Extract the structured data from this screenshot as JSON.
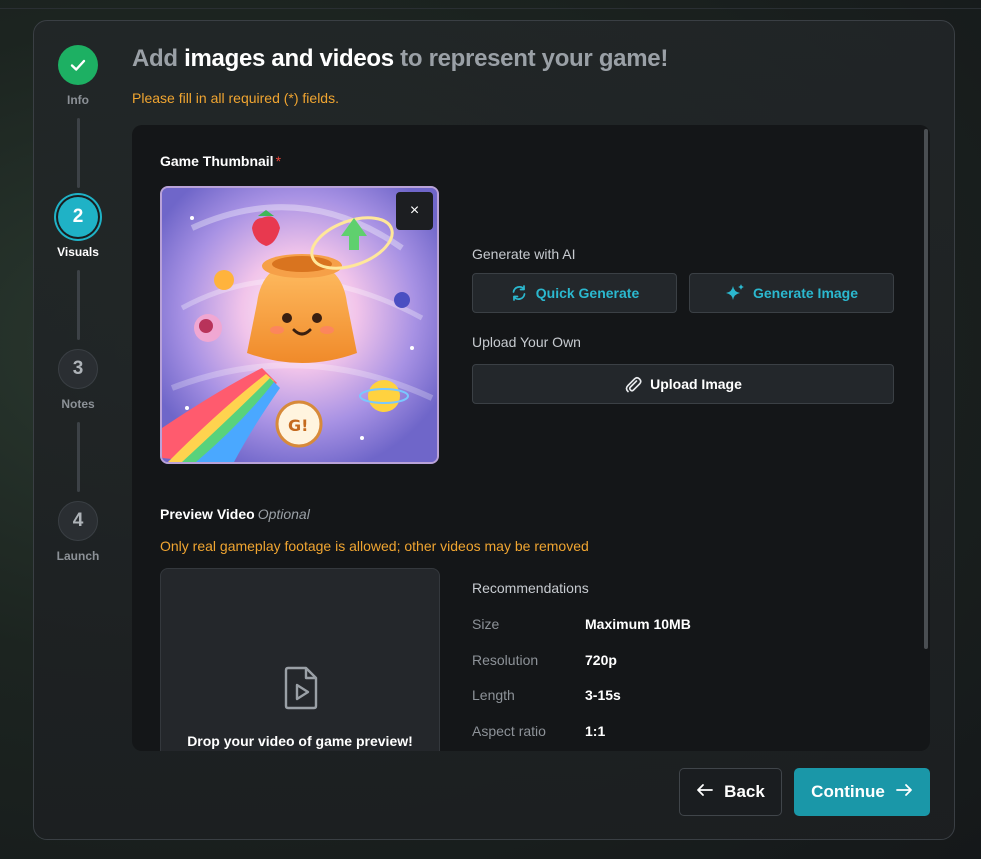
{
  "header": {
    "title_prefix": "Add",
    "title_highlight": "images and videos",
    "title_suffix": "to represent your game!",
    "required_note": "Please fill in all required (*) fields."
  },
  "stepper": {
    "steps": [
      {
        "number": "",
        "label": "Info",
        "state": "done"
      },
      {
        "number": "2",
        "label": "Visuals",
        "state": "active"
      },
      {
        "number": "3",
        "label": "Notes",
        "state": "todo"
      },
      {
        "number": "4",
        "label": "Launch",
        "state": "todo"
      }
    ]
  },
  "thumbnail": {
    "label": "Game Thumbnail",
    "required_mark": "*",
    "close_label": "×"
  },
  "ai": {
    "label": "Generate with AI",
    "quick_generate": "Quick Generate",
    "generate_image": "Generate Image"
  },
  "upload": {
    "label": "Upload Your Own",
    "button": "Upload Image"
  },
  "video": {
    "label": "Preview Video",
    "optional": "Optional",
    "warning": "Only real gameplay footage is allowed; other videos may be removed",
    "drop_text": "Drop your video of game preview!"
  },
  "recommendations": {
    "title": "Recommendations",
    "rows": [
      {
        "key": "Size",
        "value": "Maximum 10MB"
      },
      {
        "key": "Resolution",
        "value": "720p"
      },
      {
        "key": "Length",
        "value": "3-15s"
      },
      {
        "key": "Aspect ratio",
        "value": "1:1"
      }
    ]
  },
  "nav": {
    "back": "Back",
    "continue": "Continue"
  },
  "colors": {
    "accent": "#1fb2c6",
    "success": "#1db063",
    "warning": "#f0a531",
    "required": "#e7453a"
  }
}
